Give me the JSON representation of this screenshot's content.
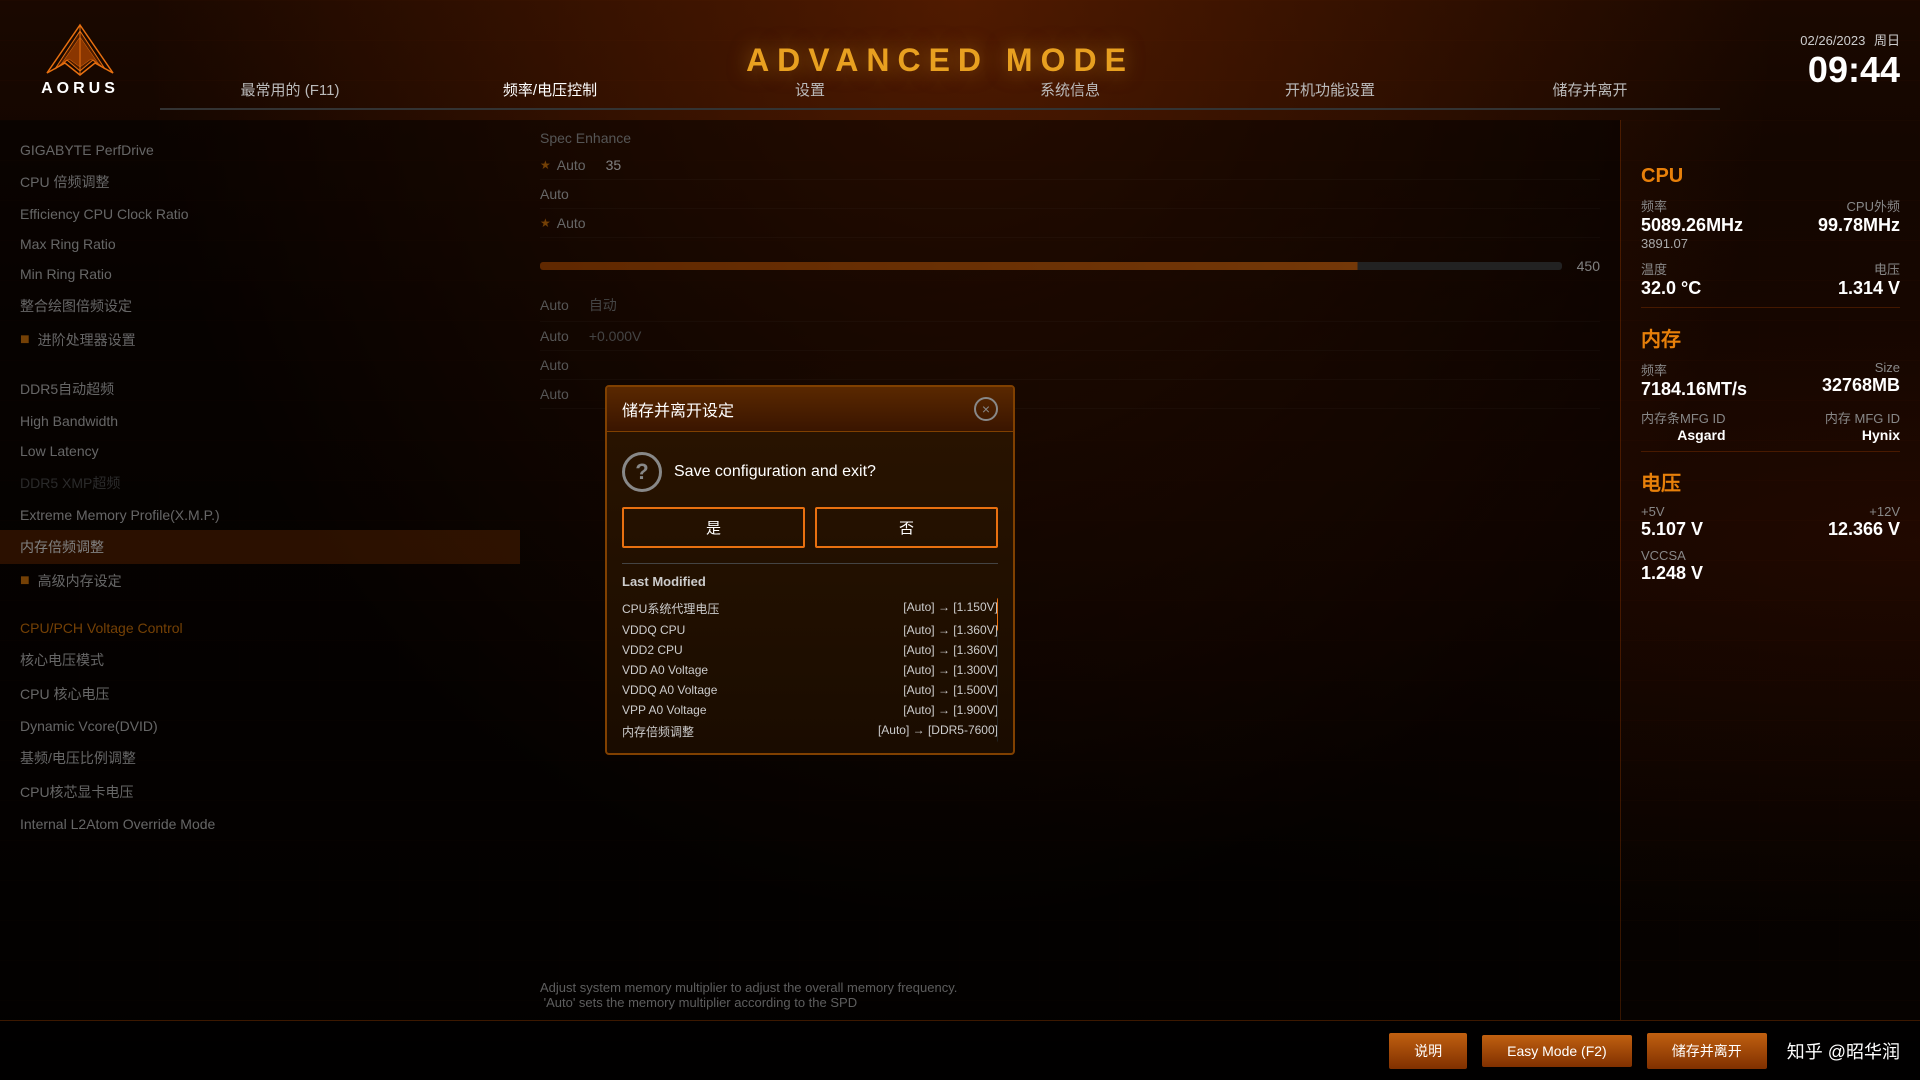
{
  "header": {
    "title": "ADVANCED MODE",
    "date": "02/26/2023",
    "weekday": "周日",
    "time": "09:44",
    "logo_text": "AORUS"
  },
  "nav": {
    "tabs": [
      {
        "id": "tab1",
        "label": "最常用的 (F11)",
        "active": false
      },
      {
        "id": "tab2",
        "label": "频率/电压控制",
        "active": true
      },
      {
        "id": "tab3",
        "label": "设置",
        "active": false
      },
      {
        "id": "tab4",
        "label": "系统信息",
        "active": false
      },
      {
        "id": "tab5",
        "label": "开机功能设置",
        "active": false
      },
      {
        "id": "tab6",
        "label": "储存并离开",
        "active": false
      }
    ]
  },
  "settings_list": {
    "items": [
      {
        "id": "item1",
        "label": "GIGABYTE PerfDrive",
        "bullet": false,
        "active": false,
        "orange": false
      },
      {
        "id": "item2",
        "label": "CPU 倍频调整",
        "bullet": false,
        "active": false,
        "orange": false
      },
      {
        "id": "item3",
        "label": "Efficiency CPU Clock Ratio",
        "bullet": false,
        "active": false,
        "orange": false
      },
      {
        "id": "item4",
        "label": "Max Ring Ratio",
        "bullet": false,
        "active": false,
        "orange": false
      },
      {
        "id": "item5",
        "label": "Min Ring Ratio",
        "bullet": false,
        "active": false,
        "orange": false
      },
      {
        "id": "item6",
        "label": "整合绘图倍频设定",
        "bullet": false,
        "active": false,
        "orange": false
      },
      {
        "id": "item7",
        "label": "进阶处理器设置",
        "bullet": true,
        "active": false,
        "orange": false
      },
      {
        "id": "item8",
        "label": "DDR5自动超频",
        "bullet": false,
        "active": false,
        "orange": false
      },
      {
        "id": "item9",
        "label": "High Bandwidth",
        "bullet": false,
        "active": false,
        "orange": false
      },
      {
        "id": "item10",
        "label": "Low Latency",
        "bullet": false,
        "active": false,
        "orange": false
      },
      {
        "id": "item11",
        "label": "DDR5 XMP超频",
        "bullet": false,
        "active": false,
        "orange": false,
        "disabled": true
      },
      {
        "id": "item12",
        "label": "Extreme Memory Profile(X.M.P.)",
        "bullet": false,
        "active": false,
        "orange": false
      },
      {
        "id": "item13",
        "label": "内存倍频调整",
        "bullet": false,
        "active": true,
        "orange": false
      },
      {
        "id": "item14",
        "label": "高级内存设定",
        "bullet": true,
        "active": false,
        "orange": false
      },
      {
        "id": "item15",
        "label": "CPU/PCH Voltage Control",
        "bullet": false,
        "active": false,
        "orange": true
      },
      {
        "id": "item16",
        "label": "核心电压模式",
        "bullet": false,
        "active": false,
        "orange": false
      },
      {
        "id": "item17",
        "label": "CPU 核心电压",
        "bullet": false,
        "active": false,
        "orange": false
      },
      {
        "id": "item18",
        "label": "Dynamic Vcore(DVID)",
        "bullet": false,
        "active": false,
        "orange": false
      },
      {
        "id": "item19",
        "label": "基频/电压比例调整",
        "bullet": false,
        "active": false,
        "orange": false
      },
      {
        "id": "item20",
        "label": "CPU核芯显卡电压",
        "bullet": false,
        "active": false,
        "orange": false
      },
      {
        "id": "item21",
        "label": "Internal L2Atom Override Mode",
        "bullet": false,
        "active": false,
        "orange": false
      }
    ]
  },
  "middle_panel": {
    "spec_enhance_label": "Spec Enhance",
    "rows": [
      {
        "star": true,
        "label": "Auto",
        "value": "35"
      },
      {
        "star": false,
        "label": "Auto",
        "value": ""
      },
      {
        "star": true,
        "label": "Auto",
        "value": ""
      }
    ],
    "slider_value": "450",
    "bottom_rows": [
      {
        "label": "Auto",
        "value": "自动"
      },
      {
        "label": "Auto",
        "value": "+0.000V"
      },
      {
        "label": "Auto",
        "value": ""
      },
      {
        "label": "Auto",
        "value": ""
      }
    ]
  },
  "right_stats": {
    "cpu_section": "CPU",
    "cpu_freq_label": "频率",
    "cpu_freq_value": "5089.26MHz",
    "cpu_ext_label": "CPU外频",
    "cpu_ext_value": "99.78MHz",
    "cpu_ratio": "3891.07",
    "cpu_temp_label": "温度",
    "cpu_temp_value": "32.0 °C",
    "cpu_volt_label": "电压",
    "cpu_volt_value": "1.314 V",
    "mem_section": "内存",
    "mem_freq_label": "频率",
    "mem_freq_value": "7184.16MT/s",
    "mem_size_label": "Size",
    "mem_size_value": "32768MB",
    "mem_mfg_label": "内存条MFG ID",
    "mem_mfg_value": "Asgard",
    "mem_mfg2_label": "内存 MFG ID",
    "mem_mfg2_value": "Hynix",
    "volt_section": "电压",
    "v5_label": "+5V",
    "v5_value": "5.107 V",
    "v12_label": "+12V",
    "v12_value": "12.366 V",
    "vccsa_label": "VCCSA",
    "vccsa_value": "1.248 V"
  },
  "modal": {
    "title": "储存并离开设定",
    "question": "Save configuration and exit?",
    "yes_button": "是",
    "no_button": "否",
    "last_modified_title": "Last Modified",
    "modified_items": [
      {
        "key": "CPU系统代理电压",
        "value": "[Auto] → [1.150V]"
      },
      {
        "key": "VDDQ CPU",
        "value": "[Auto] → [1.360V]"
      },
      {
        "key": "VDD2 CPU",
        "value": "[Auto] → [1.360V]"
      },
      {
        "key": "VDD A0 Voltage",
        "value": "[Auto] → [1.300V]"
      },
      {
        "key": "VDDQ A0 Voltage",
        "value": "[Auto] → [1.500V]"
      },
      {
        "key": "VPP A0 Voltage",
        "value": "[Auto] → [1.900V]"
      },
      {
        "key": "内存倍频调整",
        "value": "[Auto] → [DDR5-7600]"
      }
    ],
    "close_button": "×"
  },
  "bottom_bar": {
    "help_text": "说明",
    "easy_mode_btn": "Easy Mode (F2)",
    "save_btn": "储存并离开",
    "watermark": "知乎 @昭华润"
  }
}
